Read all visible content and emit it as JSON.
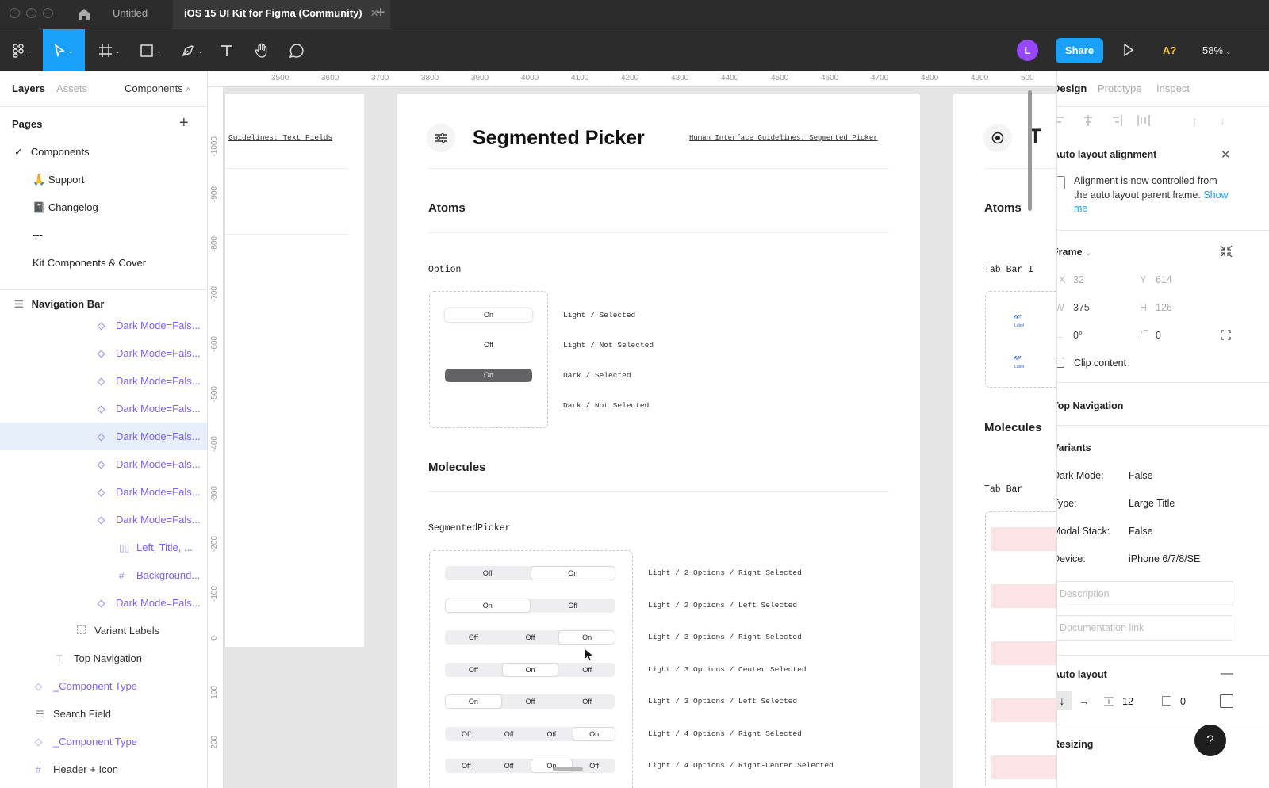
{
  "tabs": [
    "Untitled",
    "iOS 15 UI Kit for Figma (Community)"
  ],
  "toolbar": {
    "avatar": "L",
    "share": "Share",
    "fonts_warn": "A?",
    "zoom": "58%"
  },
  "left_panel": {
    "tabs": [
      "Layers",
      "Assets"
    ],
    "page_dropdown": "Components",
    "pages_header": "Pages",
    "pages": [
      "Components",
      "Support",
      "Changelog",
      "---",
      "Kit Components & Cover"
    ],
    "page_icons": [
      "🙏",
      "📓"
    ],
    "layer_root": "Navigation Bar",
    "layers": [
      {
        "label": "Dark Mode=Fals...",
        "indent": 1,
        "icon": "component-variant-icon"
      },
      {
        "label": "Dark Mode=Fals...",
        "indent": 1,
        "icon": "component-variant-icon"
      },
      {
        "label": "Dark Mode=Fals...",
        "indent": 1,
        "icon": "component-variant-icon"
      },
      {
        "label": "Dark Mode=Fals...",
        "indent": 1,
        "icon": "component-variant-icon"
      },
      {
        "label": "Dark Mode=Fals...",
        "indent": 1,
        "icon": "component-variant-icon",
        "selected": true
      },
      {
        "label": "Dark Mode=Fals...",
        "indent": 1,
        "icon": "component-variant-icon"
      },
      {
        "label": "Dark Mode=Fals...",
        "indent": 1,
        "icon": "component-variant-icon"
      },
      {
        "label": "Dark Mode=Fals...",
        "indent": 1,
        "icon": "component-variant-icon"
      },
      {
        "label": "Left, Title, ...",
        "indent": 2,
        "icon": "auto-layout-icon"
      },
      {
        "label": "Background...",
        "indent": 2,
        "icon": "frame-icon"
      },
      {
        "label": "Dark Mode=Fals...",
        "indent": 1,
        "icon": "component-variant-icon"
      },
      {
        "label": "Variant Labels",
        "indent": 0,
        "icon": "dashed-frame-icon"
      },
      {
        "label": "Top Navigation",
        "indent": -1,
        "icon": "text-icon"
      },
      {
        "label": "_Component Type",
        "indent": -2,
        "icon": "instance-icon"
      },
      {
        "label": "Search Field",
        "indent": -2,
        "icon": "frame-list-icon"
      },
      {
        "label": "_Component Type",
        "indent": -2,
        "icon": "instance-icon"
      },
      {
        "label": "Header + Icon",
        "indent": -2,
        "icon": "frame-icon"
      }
    ]
  },
  "ruler": {
    "h_labels": [
      "3500",
      "3600",
      "3700",
      "3800",
      "3900",
      "4000",
      "4100",
      "4200",
      "4300",
      "4400",
      "4500",
      "4600",
      "4700",
      "4800",
      "4900",
      "500"
    ],
    "v_labels": [
      "-1000",
      "-900",
      "-800",
      "-700",
      "-600",
      "-500",
      "-400",
      "-300",
      "-200",
      "-100",
      "0",
      "100",
      "200"
    ]
  },
  "canvas": {
    "left_link": "Guidelines: Text Fields",
    "title": "Segmented Picker",
    "hig_link": "Human Interface Guidelines: Segmented Picker",
    "atoms": "Atoms",
    "option_label": "Option",
    "options": [
      {
        "text": "On",
        "label": "Light / Selected"
      },
      {
        "text": "Off",
        "label": "Light / Not Selected"
      },
      {
        "text": "On",
        "label": "Dark / Selected"
      },
      {
        "text": "",
        "label": "Dark / Not Selected"
      }
    ],
    "molecules": "Molecules",
    "picker_label": "SegmentedPicker",
    "pickers": [
      {
        "segments": [
          "Off",
          "On"
        ],
        "selected": 1,
        "label": "Light / 2 Options / Right Selected"
      },
      {
        "segments": [
          "On",
          "Off"
        ],
        "selected": 0,
        "label": "Light / 2 Options / Left Selected"
      },
      {
        "segments": [
          "Off",
          "Off",
          "On"
        ],
        "selected": 2,
        "label": "Light / 3 Options / Right Selected"
      },
      {
        "segments": [
          "Off",
          "On",
          "Off"
        ],
        "selected": 1,
        "label": "Light / 3 Options / Center Selected"
      },
      {
        "segments": [
          "On",
          "Off",
          "Off"
        ],
        "selected": 0,
        "label": "Light / 3 Options / Left Selected"
      },
      {
        "segments": [
          "Off",
          "Off",
          "Off",
          "On"
        ],
        "selected": 3,
        "label": "Light / 4 Options / Right Selected"
      },
      {
        "segments": [
          "Off",
          "Off",
          "On",
          "Off"
        ],
        "selected": 2,
        "label": "Light / 4 Options / Right-Center Selected"
      }
    ],
    "right_frame": {
      "atoms": "Atoms",
      "tab_bar_item": "Tab Bar I",
      "molecules": "Molecules",
      "tab_bar": "Tab Bar",
      "title_partial": "T",
      "icon_label": "Label"
    }
  },
  "right_panel": {
    "tabs": [
      "Design",
      "Prototype",
      "Inspect"
    ],
    "alignment_title": "Auto layout alignment",
    "alignment_msg": "Alignment is now controlled from the auto layout parent frame.",
    "show_me": "Show me",
    "frame_label": "Frame",
    "x_label": "X",
    "x": "32",
    "y_label": "Y",
    "y": "614",
    "w_label": "W",
    "w": "375",
    "h_label": "H",
    "h": "126",
    "rotation": "0°",
    "radius": "0",
    "clip_content": "Clip content",
    "component_name": "Top Navigation",
    "variants_title": "Variants",
    "variants": [
      {
        "key": "Dark Mode:",
        "value": "False"
      },
      {
        "key": "Type:",
        "value": "Large Title"
      },
      {
        "key": "Modal Stack:",
        "value": "False"
      },
      {
        "key": "Device:",
        "value": "iPhone 6/7/8/SE"
      }
    ],
    "description_placeholder": "Description",
    "doc_link_placeholder": "Documentation link",
    "auto_layout": "Auto layout",
    "spacing": "12",
    "padding": "0",
    "resizing": "Resizing",
    "help": "?"
  },
  "colors": {
    "accent": "#18a0fb",
    "component": "#7b61ff",
    "avatar": "#9747ff",
    "chrome": "#2c2c2c"
  }
}
